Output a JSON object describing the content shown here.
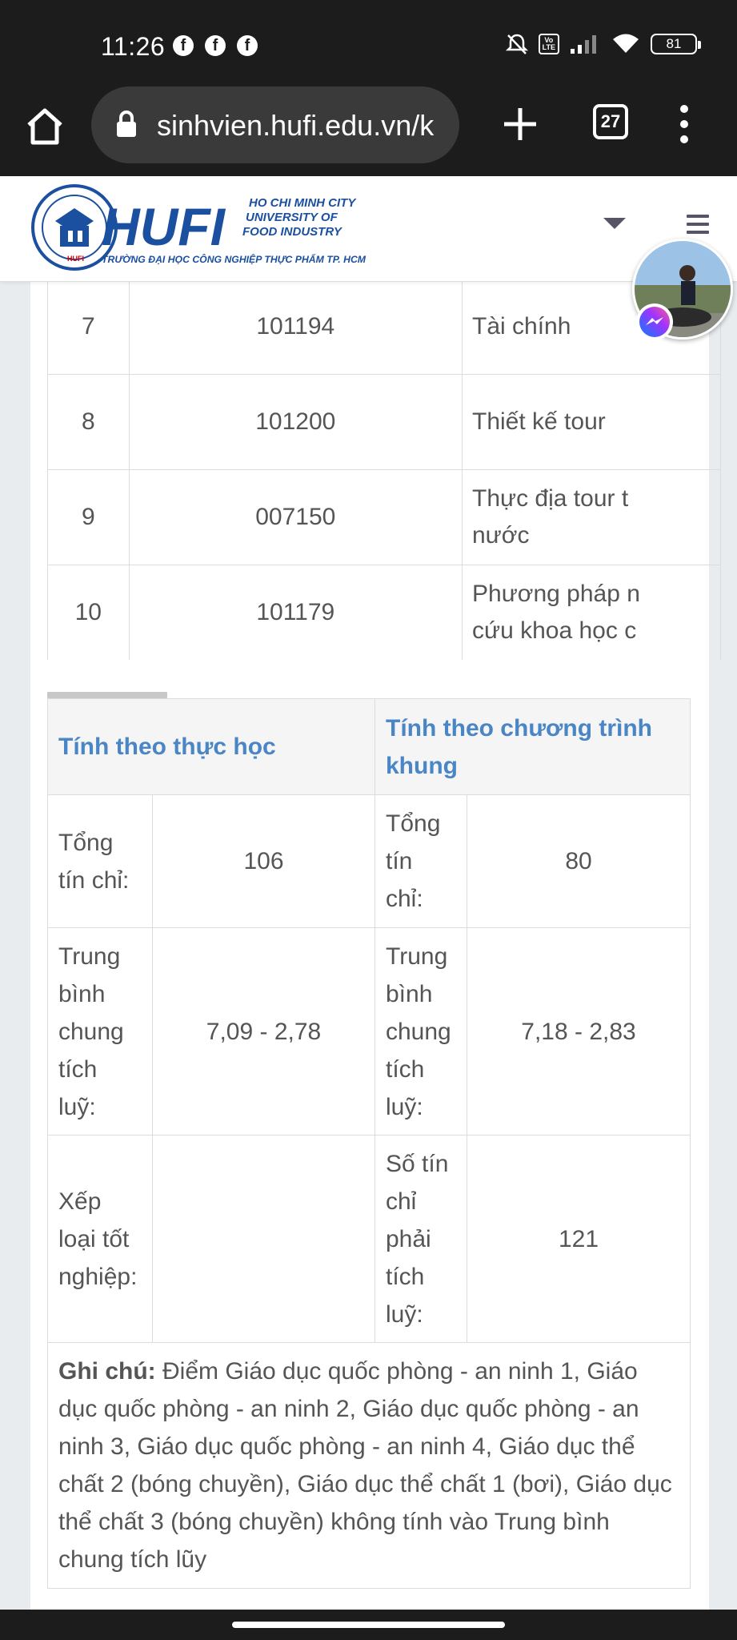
{
  "status_bar": {
    "time": "11:26",
    "notification_icons": [
      "facebook-icon",
      "facebook-icon",
      "facebook-icon"
    ],
    "volte": "Vo\nLTE",
    "battery": "81"
  },
  "browser": {
    "url": "sinhvien.hufi.edu.vn/k",
    "tab_count": "27"
  },
  "site_header": {
    "logo_main": "HUFI",
    "logo_lines": [
      "HO CHI MINH CITY",
      "UNIVERSITY OF",
      "FOOD INDUSTRY"
    ],
    "logo_sub": "TRƯỜNG ĐẠI HỌC CÔNG NGHIỆP THỰC PHẨM TP. HCM"
  },
  "courses": [
    {
      "stt": "7",
      "code": "101194",
      "name": "Tài chính"
    },
    {
      "stt": "8",
      "code": "101200",
      "name": "Thiết kế tour"
    },
    {
      "stt": "9",
      "code": "007150",
      "name": "Thực địa tour t",
      "name2": "nước"
    },
    {
      "stt": "10",
      "code": "101179",
      "name": "Phương pháp n",
      "name2": "cứu khoa học c"
    }
  ],
  "summary": {
    "col1_header": "Tính theo thực học",
    "col2_header": "Tính theo chương trình khung",
    "rows": [
      {
        "label1": "Tổng tín chỉ:",
        "value1": "106",
        "label2": "Tổng tín chỉ:",
        "value2": "80"
      },
      {
        "label1": "Trung bình chung tích luỹ:",
        "value1": "7,09 - 2,78",
        "label2": "Trung bình chung tích luỹ:",
        "value2": "7,18 - 2,83"
      },
      {
        "label1": "Xếp loại tốt nghiệp:",
        "value1": "",
        "label2": "Số tín chỉ phải tích luỹ:",
        "value2": "121"
      }
    ],
    "note_label": "Ghi chú:",
    "note_text": " Điểm Giáo dục quốc phòng - an ninh 1, Giáo dục quốc phòng - an ninh 2, Giáo dục quốc phòng - an ninh 3, Giáo dục quốc phòng - an ninh 4, Giáo dục thể chất 2 (bóng chuyền), Giáo dục thể chất 1 (bơi), Giáo dục thể chất 3 (bóng chuyền) không tính vào Trung bình chung tích lũy"
  },
  "colors": {
    "header_blue": "#4a86c5",
    "note_red": "#d10000",
    "logo_blue": "#1b4fa0"
  }
}
